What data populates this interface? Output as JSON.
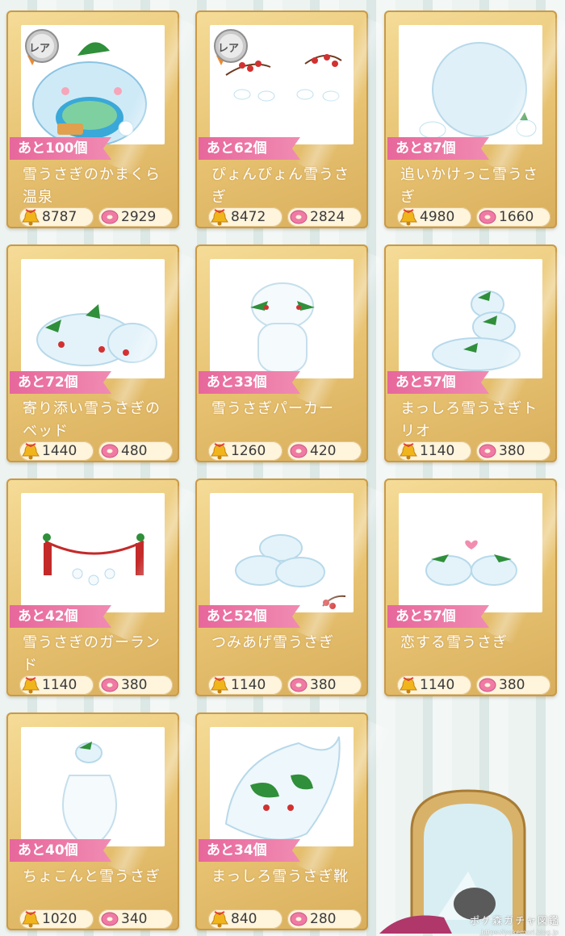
{
  "items": [
    {
      "remaining": "あと100個",
      "name": "雪うさぎのかまくら温泉",
      "bells": "8787",
      "donuts": "2929",
      "rare": true
    },
    {
      "remaining": "あと62個",
      "name": "ぴょんぴょん雪うさぎ",
      "bells": "8472",
      "donuts": "2824",
      "rare": true
    },
    {
      "remaining": "あと87個",
      "name": "追いかけっこ雪うさぎ",
      "bells": "4980",
      "donuts": "1660",
      "rare": false
    },
    {
      "remaining": "あと72個",
      "name": "寄り添い雪うさぎのベッド",
      "bells": "1440",
      "donuts": "480",
      "rare": false
    },
    {
      "remaining": "あと33個",
      "name": "雪うさぎパーカー",
      "bells": "1260",
      "donuts": "420",
      "rare": false
    },
    {
      "remaining": "あと57個",
      "name": "まっしろ雪うさぎトリオ",
      "bells": "1140",
      "donuts": "380",
      "rare": false
    },
    {
      "remaining": "あと42個",
      "name": "雪うさぎのガーランド",
      "bells": "1140",
      "donuts": "380",
      "rare": false
    },
    {
      "remaining": "あと52個",
      "name": "つみあげ雪うさぎ",
      "bells": "1140",
      "donuts": "380",
      "rare": false
    },
    {
      "remaining": "あと57個",
      "name": "恋する雪うさぎ",
      "bells": "1140",
      "donuts": "380",
      "rare": false
    },
    {
      "remaining": "あと40個",
      "name": "ちょこんと雪うさぎ",
      "bells": "1020",
      "donuts": "340",
      "rare": false
    },
    {
      "remaining": "あと34個",
      "name": "まっしろ雪うさぎ靴",
      "bells": "840",
      "donuts": "280",
      "rare": false
    }
  ],
  "rare_badge_label": "レア",
  "icons": {
    "bell": "bell-icon",
    "donut": "donut-icon"
  },
  "colors": {
    "gold_frame": "#e7c271",
    "pink_ribbon": "#e7679b",
    "price_pill": "#fff4dc"
  },
  "watermark": "ポケ森ガチャ図鑑",
  "watermark_url": "https://pokemori.blog.jp"
}
